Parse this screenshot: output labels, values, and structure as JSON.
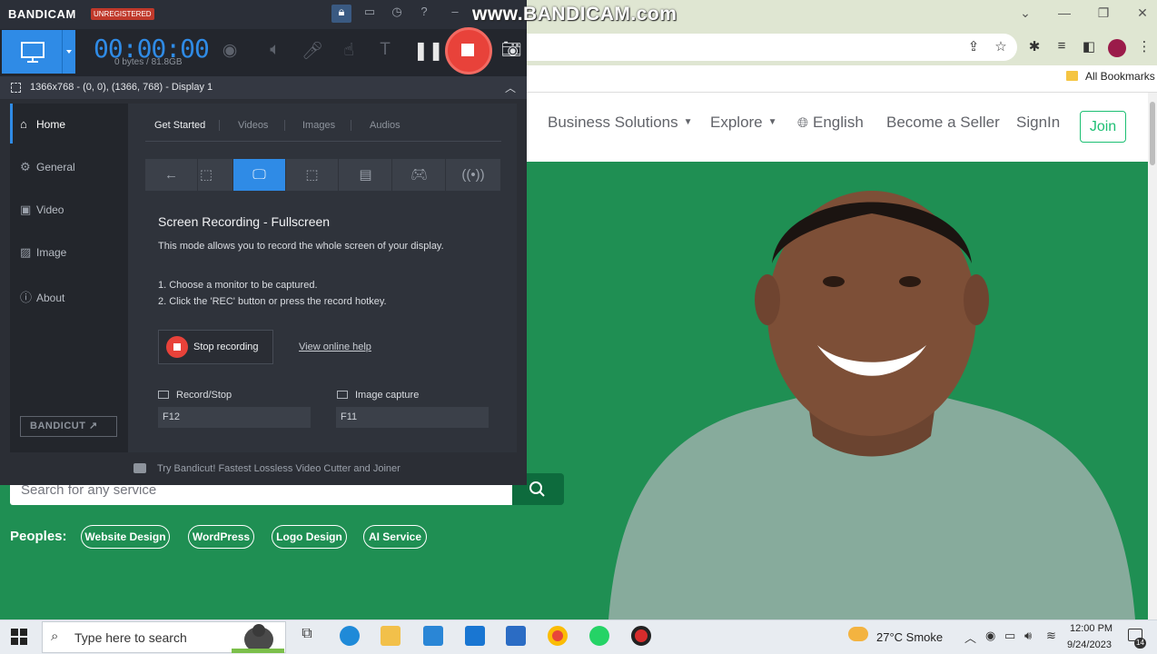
{
  "watermark": "www.BANDICAM.com",
  "chrome": {
    "bookmarks_label": "All Bookmarks",
    "window_controls": [
      "minimize-icon",
      "maximize-icon",
      "close-icon"
    ],
    "toolbar_icons": [
      "share-icon",
      "star-icon",
      "extensions-icon",
      "reading-list-icon",
      "side-panel-icon",
      "profile-icon",
      "menu-icon"
    ]
  },
  "site": {
    "nav": {
      "business": "Business Solutions",
      "explore": "Explore",
      "language": "English",
      "seller": "Become a Seller",
      "signin": "SignIn",
      "join": "Join"
    },
    "search_placeholder": "Search for any service",
    "peoples_label": "Peoples:",
    "tags": [
      "Website Design",
      "WordPress",
      "Logo Design",
      "AI Service"
    ],
    "colors": {
      "hero": "#1f8f53",
      "accent": "#1dbf73",
      "search_button": "#0d6b3d"
    }
  },
  "bandicam": {
    "logo": "BANDICAM",
    "badge": "UNREGISTERED",
    "timer": "00:00:00",
    "size": "0 bytes / 81.8GB",
    "target": "1366x768 - (0, 0), (1366, 768) - Display 1",
    "sidebar": [
      {
        "label": "Home",
        "icon": "home-icon"
      },
      {
        "label": "General",
        "icon": "gear-icon"
      },
      {
        "label": "Video",
        "icon": "video-icon"
      },
      {
        "label": "Image",
        "icon": "image-icon"
      },
      {
        "label": "About",
        "icon": "info-icon"
      }
    ],
    "tabs": [
      "Get Started",
      "Videos",
      "Images",
      "Audios"
    ],
    "modes": [
      "back-arrow-icon",
      "rectangle-area-icon",
      "fullscreen-icon",
      "around-mouse-icon",
      "hdmi-device-icon",
      "game-icon",
      "audio-only-icon"
    ],
    "section_title": "Screen Recording - Fullscreen",
    "section_desc": "This mode allows you to record the whole screen of your display.",
    "steps": [
      "1. Choose a monitor to be captured.",
      "2. Click the 'REC' button or press the record hotkey."
    ],
    "stop_label": "Stop recording",
    "help_link": "View online help",
    "hotkeys": [
      {
        "label": "Record/Stop",
        "key": "F12"
      },
      {
        "label": "Image capture",
        "key": "F11"
      }
    ],
    "bandicut": "BANDICUT",
    "footer": "Try Bandicut! Fastest Lossless Video Cutter and Joiner",
    "colors": {
      "accent": "#2f8be6",
      "record": "#e8423a"
    }
  },
  "taskbar": {
    "search_text": "Type here to search",
    "weather": "27°C  Smoke",
    "time": "12:00 PM",
    "date": "9/24/2023",
    "notification_count": "14",
    "apps": [
      "task-view-icon",
      "edge-icon",
      "file-explorer-icon",
      "vscode-icon",
      "mail-icon",
      "store-icon",
      "chrome-icon",
      "whatsapp-icon",
      "bandicam-icon"
    ]
  }
}
